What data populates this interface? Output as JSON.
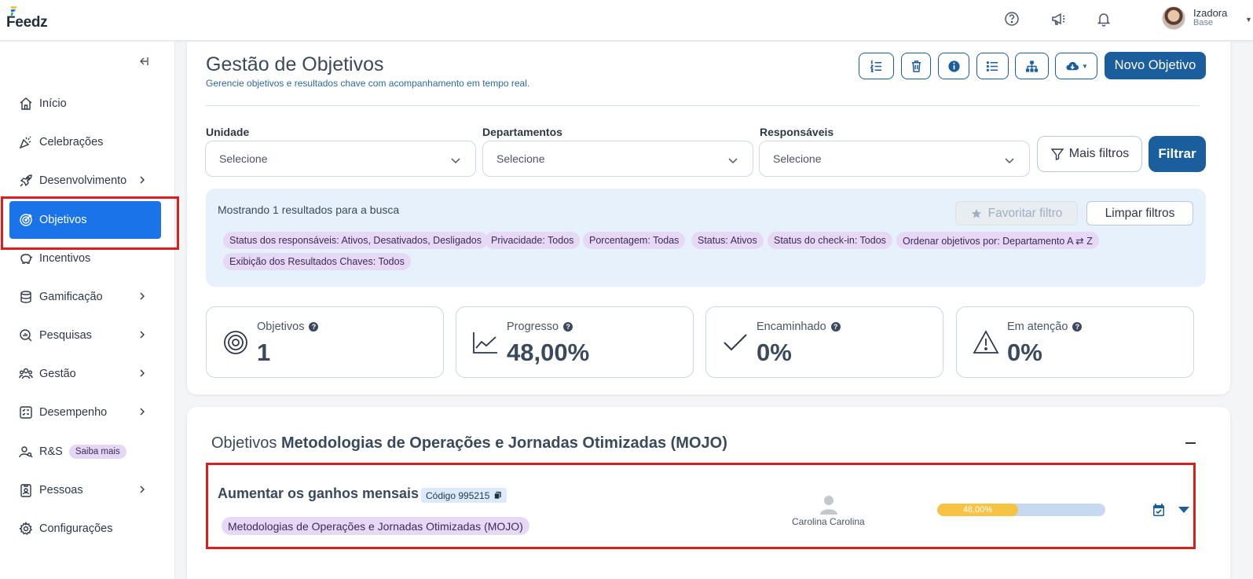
{
  "app": {
    "name": "Feedz"
  },
  "user": {
    "name": "Izadora",
    "role": "Base"
  },
  "sidebar": {
    "items": [
      {
        "label": "Início",
        "icon": "home-icon",
        "has_submenu": false
      },
      {
        "label": "Celebrações",
        "icon": "party-popper-icon",
        "has_submenu": false
      },
      {
        "label": "Desenvolvimento",
        "icon": "rocket-icon",
        "has_submenu": true
      },
      {
        "label": "Objetivos",
        "icon": "target-icon",
        "has_submenu": false,
        "active": true
      },
      {
        "label": "Incentivos",
        "icon": "piggy-bank-icon",
        "has_submenu": false
      },
      {
        "label": "Gamificação",
        "icon": "coins-icon",
        "has_submenu": true
      },
      {
        "label": "Pesquisas",
        "icon": "search-chart-icon",
        "has_submenu": true
      },
      {
        "label": "Gestão",
        "icon": "people-icon",
        "has_submenu": true
      },
      {
        "label": "Desempenho",
        "icon": "checklist-icon",
        "has_submenu": true
      },
      {
        "label": "R&S",
        "icon": "person-search-icon",
        "has_submenu": false,
        "badge": "Saiba mais"
      },
      {
        "label": "Pessoas",
        "icon": "id-badge-icon",
        "has_submenu": true
      },
      {
        "label": "Configurações",
        "icon": "gear-icon",
        "has_submenu": false
      }
    ]
  },
  "page": {
    "title": "Gestão de Objetivos",
    "subtitle": "Gerencie objetivos e resultados chave com acompanhamento em tempo real.",
    "new_button": "Novo Objetivo"
  },
  "filters": {
    "unidade": {
      "label": "Unidade",
      "placeholder": "Selecione"
    },
    "departamentos": {
      "label": "Departamentos",
      "placeholder": "Selecione"
    },
    "responsaveis": {
      "label": "Responsáveis",
      "placeholder": "Selecione"
    },
    "more_filters": "Mais filtros",
    "filter_button": "Filtrar"
  },
  "results": {
    "summary": "Mostrando 1 resultados para a busca",
    "favorite_button": "Favoritar filtro",
    "clear_button": "Limpar filtros",
    "chips": [
      "Status dos responsáveis: Ativos, Desativados, Desligados",
      "Privacidade: Todos",
      "Porcentagem: Todas",
      "Status: Ativos",
      "Status do check-in: Todos",
      "Ordenar objetivos por: Departamento A ⇄ Z",
      "Exibição dos Resultados Chaves: Todos"
    ]
  },
  "stats": [
    {
      "label": "Objetivos",
      "value": "1",
      "icon": "target-icon"
    },
    {
      "label": "Progresso",
      "value": "48,00%",
      "icon": "line-chart-icon"
    },
    {
      "label": "Encaminhado",
      "value": "0%",
      "icon": "check-icon"
    },
    {
      "label": "Em atenção",
      "value": "0%",
      "icon": "warning-icon"
    }
  ],
  "objectives_section": {
    "prefix": "Objetivos",
    "department": "Metodologias de Operações e Jornadas Otimizadas (MOJO)",
    "items": [
      {
        "title": "Aumentar os ganhos mensais",
        "code": "Código 995215",
        "department_tag": "Metodologias de Operações e Jornadas Otimizadas (MOJO)",
        "owner": "Carolina Carolina",
        "progress_label": "48,00%",
        "progress_value": 0.48
      }
    ]
  },
  "colors": {
    "primary": "#1b5e9e",
    "active_nav": "#1a73e8",
    "chip_bg": "#e5d9f6",
    "progress_fill": "#f6c343",
    "progress_track": "#c5daf0",
    "highlight": "#d9201f"
  }
}
